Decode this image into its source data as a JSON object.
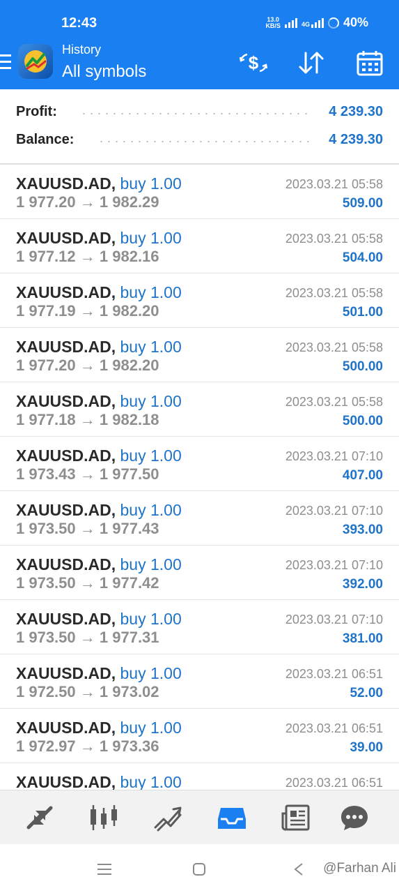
{
  "status_bar": {
    "time": "12:43",
    "net_speed_value": "13.0",
    "net_speed_unit": "KB/S",
    "network_label": "4G",
    "battery": "40%"
  },
  "header": {
    "subtitle": "History",
    "title": "All symbols",
    "icons": [
      "menu-icon",
      "metatrader-logo",
      "currency-exchange-icon",
      "sort-icon",
      "calendar-icon"
    ]
  },
  "summary": {
    "profit_label": "Profit:",
    "profit_value": "4 239.30",
    "balance_label": "Balance:",
    "balance_value": "4 239.30"
  },
  "trades": [
    {
      "symbol": "XAUUSD.AD,",
      "direction": "buy",
      "volume": "1.00",
      "open_price": "1 977.20",
      "close_price": "1 982.29",
      "time": "2023.03.21 05:58",
      "profit": "509.00"
    },
    {
      "symbol": "XAUUSD.AD,",
      "direction": "buy",
      "volume": "1.00",
      "open_price": "1 977.12",
      "close_price": "1 982.16",
      "time": "2023.03.21 05:58",
      "profit": "504.00"
    },
    {
      "symbol": "XAUUSD.AD,",
      "direction": "buy",
      "volume": "1.00",
      "open_price": "1 977.19",
      "close_price": "1 982.20",
      "time": "2023.03.21 05:58",
      "profit": "501.00"
    },
    {
      "symbol": "XAUUSD.AD,",
      "direction": "buy",
      "volume": "1.00",
      "open_price": "1 977.20",
      "close_price": "1 982.20",
      "time": "2023.03.21 05:58",
      "profit": "500.00"
    },
    {
      "symbol": "XAUUSD.AD,",
      "direction": "buy",
      "volume": "1.00",
      "open_price": "1 977.18",
      "close_price": "1 982.18",
      "time": "2023.03.21 05:58",
      "profit": "500.00"
    },
    {
      "symbol": "XAUUSD.AD,",
      "direction": "buy",
      "volume": "1.00",
      "open_price": "1 973.43",
      "close_price": "1 977.50",
      "time": "2023.03.21 07:10",
      "profit": "407.00"
    },
    {
      "symbol": "XAUUSD.AD,",
      "direction": "buy",
      "volume": "1.00",
      "open_price": "1 973.50",
      "close_price": "1 977.43",
      "time": "2023.03.21 07:10",
      "profit": "393.00"
    },
    {
      "symbol": "XAUUSD.AD,",
      "direction": "buy",
      "volume": "1.00",
      "open_price": "1 973.50",
      "close_price": "1 977.42",
      "time": "2023.03.21 07:10",
      "profit": "392.00"
    },
    {
      "symbol": "XAUUSD.AD,",
      "direction": "buy",
      "volume": "1.00",
      "open_price": "1 973.50",
      "close_price": "1 977.31",
      "time": "2023.03.21 07:10",
      "profit": "381.00"
    },
    {
      "symbol": "XAUUSD.AD,",
      "direction": "buy",
      "volume": "1.00",
      "open_price": "1 972.50",
      "close_price": "1 973.02",
      "time": "2023.03.21 06:51",
      "profit": "52.00"
    },
    {
      "symbol": "XAUUSD.AD,",
      "direction": "buy",
      "volume": "1.00",
      "open_price": "1 972.97",
      "close_price": "1 973.36",
      "time": "2023.03.21 06:51",
      "profit": "39.00"
    },
    {
      "symbol": "XAUUSD.AD,",
      "direction": "buy",
      "volume": "1.00",
      "open_price": "",
      "close_price": "",
      "time": "2023.03.21 06:51",
      "profit": ""
    }
  ],
  "price_arrow": "→",
  "tabbar": {
    "tabs": [
      {
        "name": "quotes-tab",
        "icon": "arrows-icon",
        "active": false
      },
      {
        "name": "chart-tab",
        "icon": "candlestick-icon",
        "active": false
      },
      {
        "name": "trade-tab",
        "icon": "trend-icon",
        "active": false
      },
      {
        "name": "history-tab",
        "icon": "inbox-icon",
        "active": true
      },
      {
        "name": "news-tab",
        "icon": "newspaper-icon",
        "active": false
      },
      {
        "name": "messages-tab",
        "icon": "chat-icon",
        "active": false
      }
    ],
    "active_color": "#1a7ff0",
    "inactive_color": "#5a5a5a"
  },
  "system_nav": {
    "watermark": "@Farhan Ali"
  },
  "colors": {
    "header_bg": "#1a7ff0",
    "accent_blue": "#1f73c8",
    "muted_text": "#8e8e8e"
  }
}
